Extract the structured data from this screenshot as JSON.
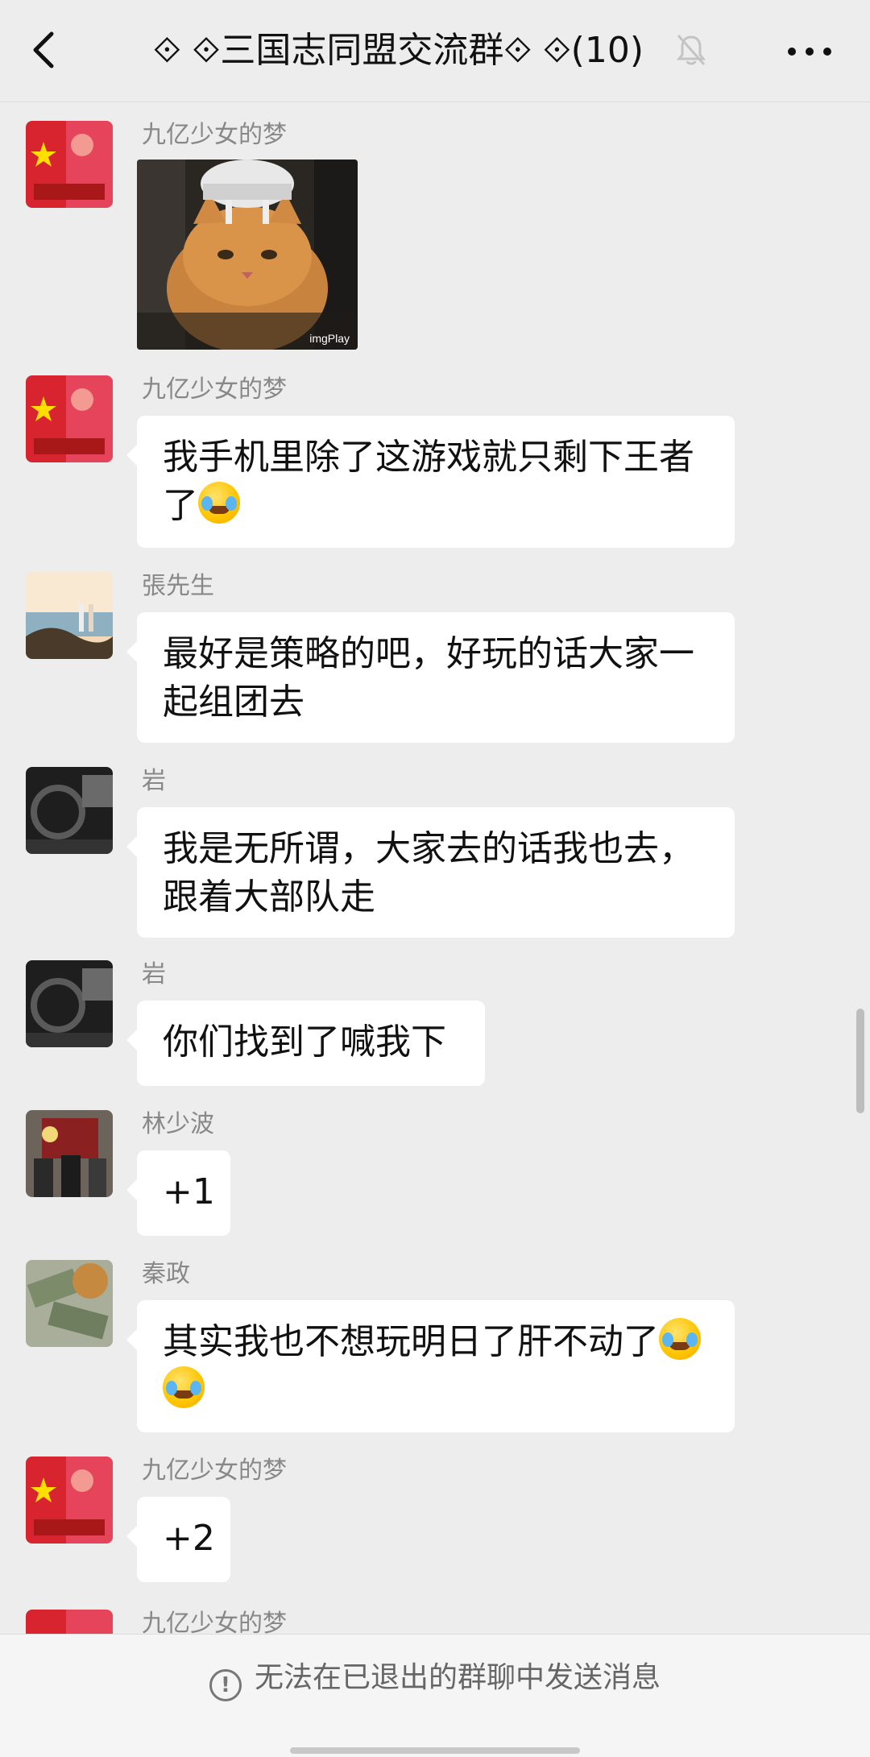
{
  "header": {
    "title": "⟐ ⟐三国志同盟交流群⟐ ⟐(10)",
    "back_icon": "chevron-left-icon",
    "mute_icon": "bell-muted-icon",
    "more_icon": "more-dots-icon"
  },
  "messages": [
    {
      "sender": "九亿少女的梦",
      "type": "image",
      "image_caption": "imgPlay"
    },
    {
      "sender": "九亿少女的梦",
      "text_lines": [
        "我手机里除了这游戏就只剩下王者",
        "了"
      ],
      "emoji": "crying-laughing"
    },
    {
      "sender": "張先生",
      "text_lines": [
        "最好是策略的吧，好玩的话大家一",
        "起组团去"
      ]
    },
    {
      "sender": "岩",
      "text_lines": [
        "我是无所谓，大家去的话我也去，",
        "跟着大部队走"
      ]
    },
    {
      "sender": "岩",
      "text_lines": [
        "你们找到了喊我下"
      ]
    },
    {
      "sender": "林少波",
      "text_lines": [
        "+1"
      ]
    },
    {
      "sender": "秦政",
      "text_lines": [
        "其实我也不想玩明日了肝不动了",
        ""
      ],
      "emoji": "crying-laughing"
    },
    {
      "sender": "九亿少女的梦",
      "text_lines": [
        "+2"
      ]
    },
    {
      "sender": "九亿少女的梦"
    }
  ],
  "footer": {
    "notice": "无法在已退出的群聊中发送消息",
    "notice_icon": "exclamation-circle-icon"
  },
  "colors": {
    "background": "#ededed",
    "bubble": "#ffffff",
    "name": "#888888"
  }
}
